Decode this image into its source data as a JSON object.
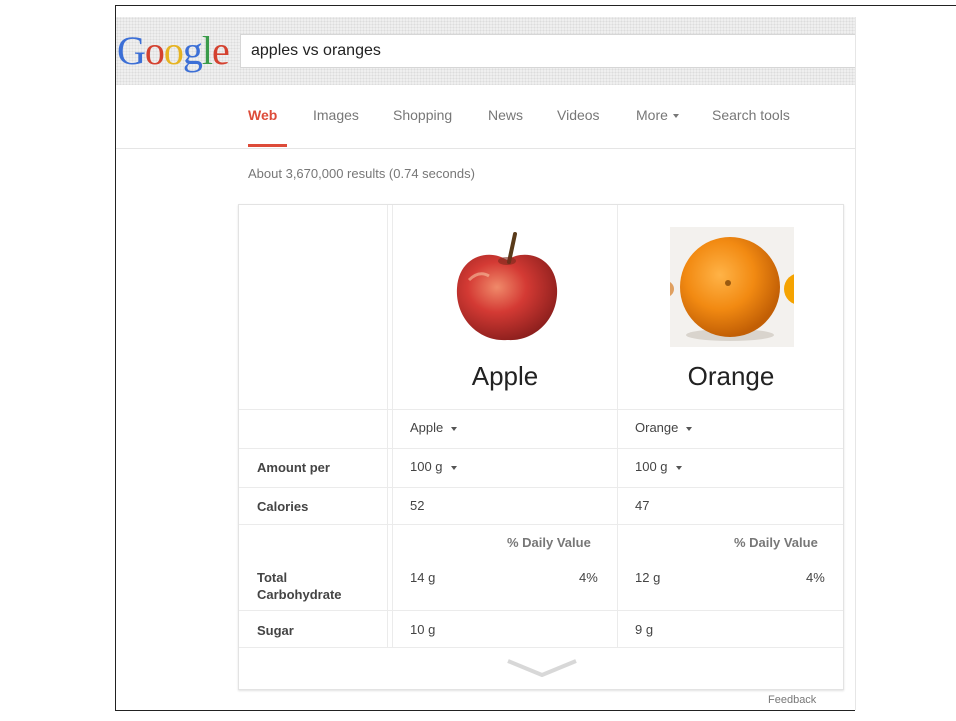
{
  "search": {
    "query": "apples vs oranges"
  },
  "tabs": [
    {
      "label": "Web"
    },
    {
      "label": "Images"
    },
    {
      "label": "Shopping"
    },
    {
      "label": "News"
    },
    {
      "label": "Videos"
    },
    {
      "label": "More"
    },
    {
      "label": "Search tools"
    }
  ],
  "result_stats": "About 3,670,000 results (0.74 seconds)",
  "comparison": {
    "foods": [
      {
        "name": "Apple",
        "selector": "Apple",
        "amount": "100 g",
        "calories": "52",
        "dv_header": "% Daily Value",
        "carbohydrate": "14 g",
        "carbohydrate_dv": "4%",
        "sugar": "10 g"
      },
      {
        "name": "Orange",
        "selector": "Orange",
        "amount": "100 g",
        "calories": "47",
        "dv_header": "% Daily Value",
        "carbohydrate": "12 g",
        "carbohydrate_dv": "4%",
        "sugar": "9 g"
      }
    ],
    "row_labels": {
      "amount_per": "Amount per",
      "calories": "Calories",
      "total_carbohydrate_1": "Total",
      "total_carbohydrate_2": "Carbohydrate",
      "sugar": "Sugar"
    }
  },
  "feedback": "Feedback",
  "icons": [
    "google-logo",
    "apple-image",
    "orange-image",
    "chevron-down-icon",
    "caret-down-icon"
  ]
}
